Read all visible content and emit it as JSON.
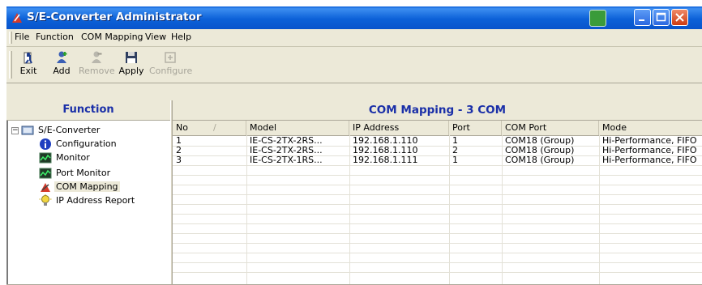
{
  "window": {
    "title": "S/E-Converter Administrator"
  },
  "menu": {
    "items": [
      "File",
      "Function",
      "COM Mapping",
      "View",
      "Help"
    ]
  },
  "toolbar": {
    "buttons": [
      {
        "label": "Exit",
        "icon": "exit-icon",
        "enabled": true
      },
      {
        "label": "Add",
        "icon": "add-user-icon",
        "enabled": true
      },
      {
        "label": "Remove",
        "icon": "remove-icon",
        "enabled": false
      },
      {
        "label": "Apply",
        "icon": "floppy-disk-icon",
        "enabled": true
      },
      {
        "label": "Configure",
        "icon": "configure-icon",
        "enabled": false
      }
    ]
  },
  "left_panel": {
    "title": "Function",
    "tree": {
      "root": "S/E-Converter",
      "children": [
        "Configuration",
        "Monitor",
        "Port Monitor",
        "COM Mapping",
        "IP Address Report"
      ],
      "selected": "COM Mapping"
    }
  },
  "main": {
    "title": "COM Mapping - 3 COM",
    "columns": [
      "No",
      "Model",
      "IP Address",
      "Port",
      "COM Port",
      "Mode"
    ],
    "sort_indicator": "/",
    "rows": [
      [
        "1",
        "IE-CS-2TX-2RS...",
        "192.168.1.110",
        "1",
        "COM18 (Group)",
        "Hi-Performance, FIFO"
      ],
      [
        "2",
        "IE-CS-2TX-2RS...",
        "192.168.1.110",
        "2",
        "COM18 (Group)",
        "Hi-Performance, FIFO"
      ],
      [
        "3",
        "IE-CS-2TX-1RS...",
        "192.168.1.111",
        "1",
        "COM18 (Group)",
        "Hi-Performance, FIFO"
      ]
    ]
  },
  "colors": {
    "title_bar": "#0c61d8",
    "panel_title_text": "#1a2fa8",
    "window_bg": "#ece9d8"
  }
}
